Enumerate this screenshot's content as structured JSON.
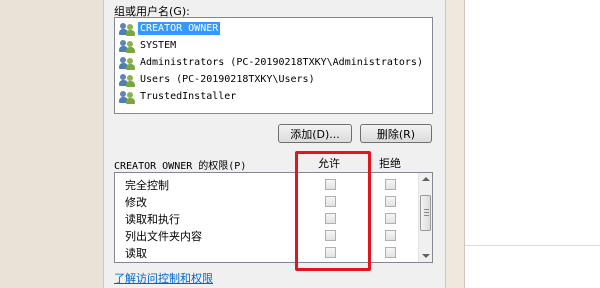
{
  "group": {
    "label": "组或用户名(G):",
    "items": [
      {
        "label": "CREATOR OWNER",
        "selected": true,
        "icon": "users-icon"
      },
      {
        "label": "SYSTEM",
        "selected": false,
        "icon": "users-icon"
      },
      {
        "label": "Administrators (PC-20190218TXKY\\Administrators)",
        "selected": false,
        "icon": "users-icon"
      },
      {
        "label": "Users (PC-20190218TXKY\\Users)",
        "selected": false,
        "icon": "users-icon"
      },
      {
        "label": "TrustedInstaller",
        "selected": false,
        "icon": "users-icon"
      }
    ]
  },
  "buttons": {
    "add_label": "添加(D)...",
    "remove_label": "删除(R)"
  },
  "permissions": {
    "label": "CREATOR OWNER 的权限(P)",
    "allow_header": "允许",
    "deny_header": "拒绝",
    "rows": [
      {
        "name": "完全控制",
        "allow": false,
        "deny": false
      },
      {
        "name": "修改",
        "allow": false,
        "deny": false
      },
      {
        "name": "读取和执行",
        "allow": false,
        "deny": false
      },
      {
        "name": "列出文件夹内容",
        "allow": false,
        "deny": false
      },
      {
        "name": "读取",
        "allow": false,
        "deny": false
      }
    ]
  },
  "link_text": "了解访问控制和权限",
  "colors": {
    "selection": "#3399ff",
    "highlight_box": "#e2141d",
    "link": "#0066cc"
  }
}
